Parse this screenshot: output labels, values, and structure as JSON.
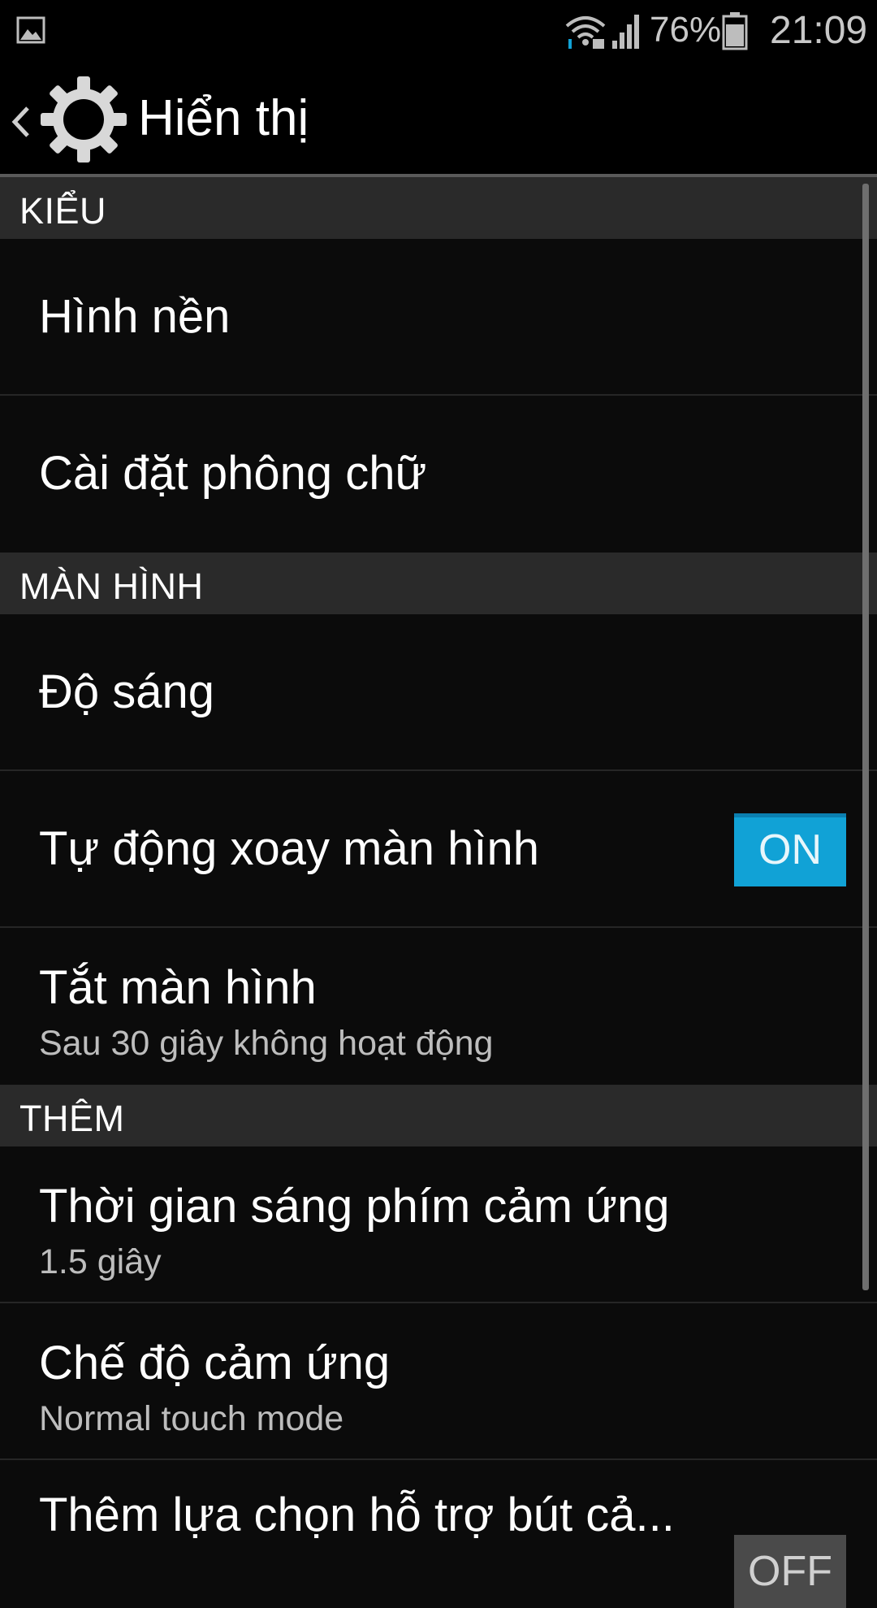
{
  "status_bar": {
    "battery_percent": "76%",
    "time": "21:09",
    "icons": [
      "gallery-icon",
      "wifi-icon",
      "signal-icon",
      "battery-icon"
    ]
  },
  "action_bar": {
    "title": "Hiển thị",
    "icons": [
      "back-icon",
      "settings-icon"
    ]
  },
  "sections": [
    {
      "header": "KIỂU",
      "items": [
        {
          "title": "Hình nền"
        },
        {
          "title": "Cài đặt phông chữ"
        }
      ]
    },
    {
      "header": "MÀN HÌNH",
      "items": [
        {
          "title": "Độ sáng"
        },
        {
          "title": "Tự động xoay màn hình",
          "toggle": "ON"
        },
        {
          "title": "Tắt màn hình",
          "subtitle": "Sau 30 giây không hoạt động"
        }
      ]
    },
    {
      "header": "THÊM",
      "items": [
        {
          "title": "Thời gian sáng phím cảm ứng",
          "subtitle": "1.5 giây"
        },
        {
          "title": "Chế độ cảm ứng",
          "subtitle": "Normal touch mode"
        },
        {
          "title": "Thêm lựa chọn hỗ trợ bút cả...",
          "toggle": "OFF"
        }
      ]
    }
  ],
  "colors": {
    "toggle_on": "#11a2d6",
    "section_header_bg": "#2a2a2a",
    "background": "#0b0b0b"
  }
}
